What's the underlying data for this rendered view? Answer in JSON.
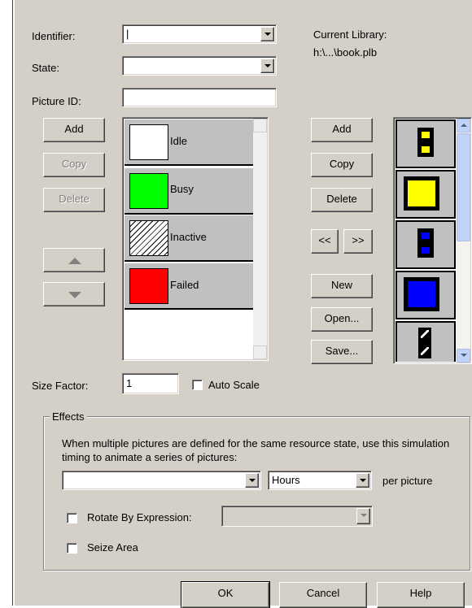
{
  "labels": {
    "identifier": "Identifier:",
    "state": "State:",
    "picture_id": "Picture ID:",
    "current_library": "Current Library:",
    "library_path": "h:\\...\\book.plb",
    "size_factor": "Size Factor:",
    "auto_scale": "Auto Scale"
  },
  "fields": {
    "identifier_value": "|",
    "state_value": "",
    "picture_id_value": "",
    "size_factor_value": "1"
  },
  "state_buttons": {
    "add": "Add",
    "copy": "Copy",
    "delete": "Delete"
  },
  "states": [
    {
      "name": "Idle",
      "color": "#ffffff"
    },
    {
      "name": "Busy",
      "color": "#00ff00"
    },
    {
      "name": "Inactive",
      "color": "hatched"
    },
    {
      "name": "Failed",
      "color": "#ff0000"
    }
  ],
  "library_buttons": {
    "add": "Add",
    "copy": "Copy",
    "delete": "Delete",
    "prev": "<<",
    "next": ">>",
    "new": "New",
    "open": "Open...",
    "save": "Save..."
  },
  "library_pictures": [
    {
      "name": "two-yellow-squares",
      "color": "#ffff00"
    },
    {
      "name": "yellow-square",
      "color": "#ffff00"
    },
    {
      "name": "two-blue-squares",
      "color": "#0000ff"
    },
    {
      "name": "blue-square",
      "color": "#0000ff"
    },
    {
      "name": "white-diagonal-squares",
      "color": "#ffffff"
    }
  ],
  "effects": {
    "group_title": "Effects",
    "description": "When multiple pictures are defined for the same resource state, use this simulation timing to animate a series of pictures:",
    "timing_value": "",
    "units_value": "Hours",
    "per_picture": "per picture",
    "rotate_label": "Rotate By Expression:",
    "rotate_value": "",
    "seize_label": "Seize Area"
  },
  "dialog_buttons": {
    "ok": "OK",
    "cancel": "Cancel",
    "help": "Help"
  }
}
